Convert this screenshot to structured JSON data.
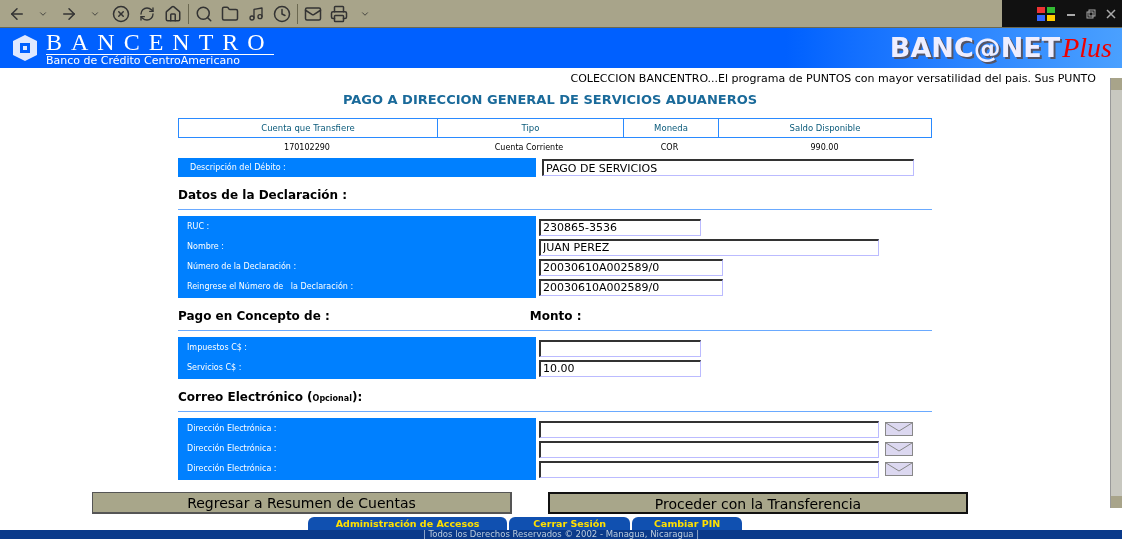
{
  "header": {
    "brand": "BANCENTRO",
    "subtitle": "Banco de Crédito CentroAmericano",
    "product": "BANC@NET",
    "product_suffix": "Plus"
  },
  "marquee": "COLECCION BANCENTRO...El programa de PUNTOS con mayor versatilidad del pais. Sus PUNTO",
  "title": "PAGO A DIRECCION GENERAL DE SERVICIOS ADUANEROS",
  "account_table": {
    "columns": [
      "Cuenta que Transfiere",
      "Tipo",
      "Moneda",
      "Saldo Disponible"
    ],
    "row": [
      "170102290",
      "Cuenta Corriente",
      "COR",
      "990.00"
    ]
  },
  "debit": {
    "label": "Descripción del Débito :",
    "value": "PAGO DE SERVICIOS"
  },
  "sections": [
    {
      "kind": "form",
      "heading": "Datos de la Declaración :",
      "fields": [
        {
          "label": "RUC :",
          "value": "230865-3536"
        },
        {
          "label": "Nombre :",
          "value": "JUAN PEREZ"
        },
        {
          "label": "Número de la Declaración :",
          "value": "20030610A002589/0"
        },
        {
          "label": "Reingrese el Número de   la Declaración :",
          "value": "20030610A002589/0"
        }
      ]
    },
    {
      "kind": "form",
      "heading": "Pago en Concepto de :",
      "heading_2": "Monto :",
      "fields": [
        {
          "label": "Impuestos C$ :"
        },
        {
          "label": "Servicios C$ :",
          "value": "10.00"
        }
      ]
    },
    {
      "kind": "email",
      "heading": "Correo Electrónico (",
      "heading_small": "Opcional",
      "heading_end": "):",
      "fields": [
        {
          "label": "Dirección Electrónica :"
        },
        {
          "label": "Dirección Electrónica :"
        },
        {
          "label": "Dirección Electrónica :"
        }
      ]
    }
  ],
  "buttons": [
    {
      "label": "Regresar a Resumen de Cuentas",
      "focused": false
    },
    {
      "label": "Proceder con la Transferencia",
      "focused": true
    }
  ],
  "footer_tabs": [
    "Administración de Accesos",
    "Cerrar Sesión",
    "Cambiar PIN"
  ],
  "footer": "| Todos los Derechos Reservados © 2002 -  Managua, Nicaragua |"
}
